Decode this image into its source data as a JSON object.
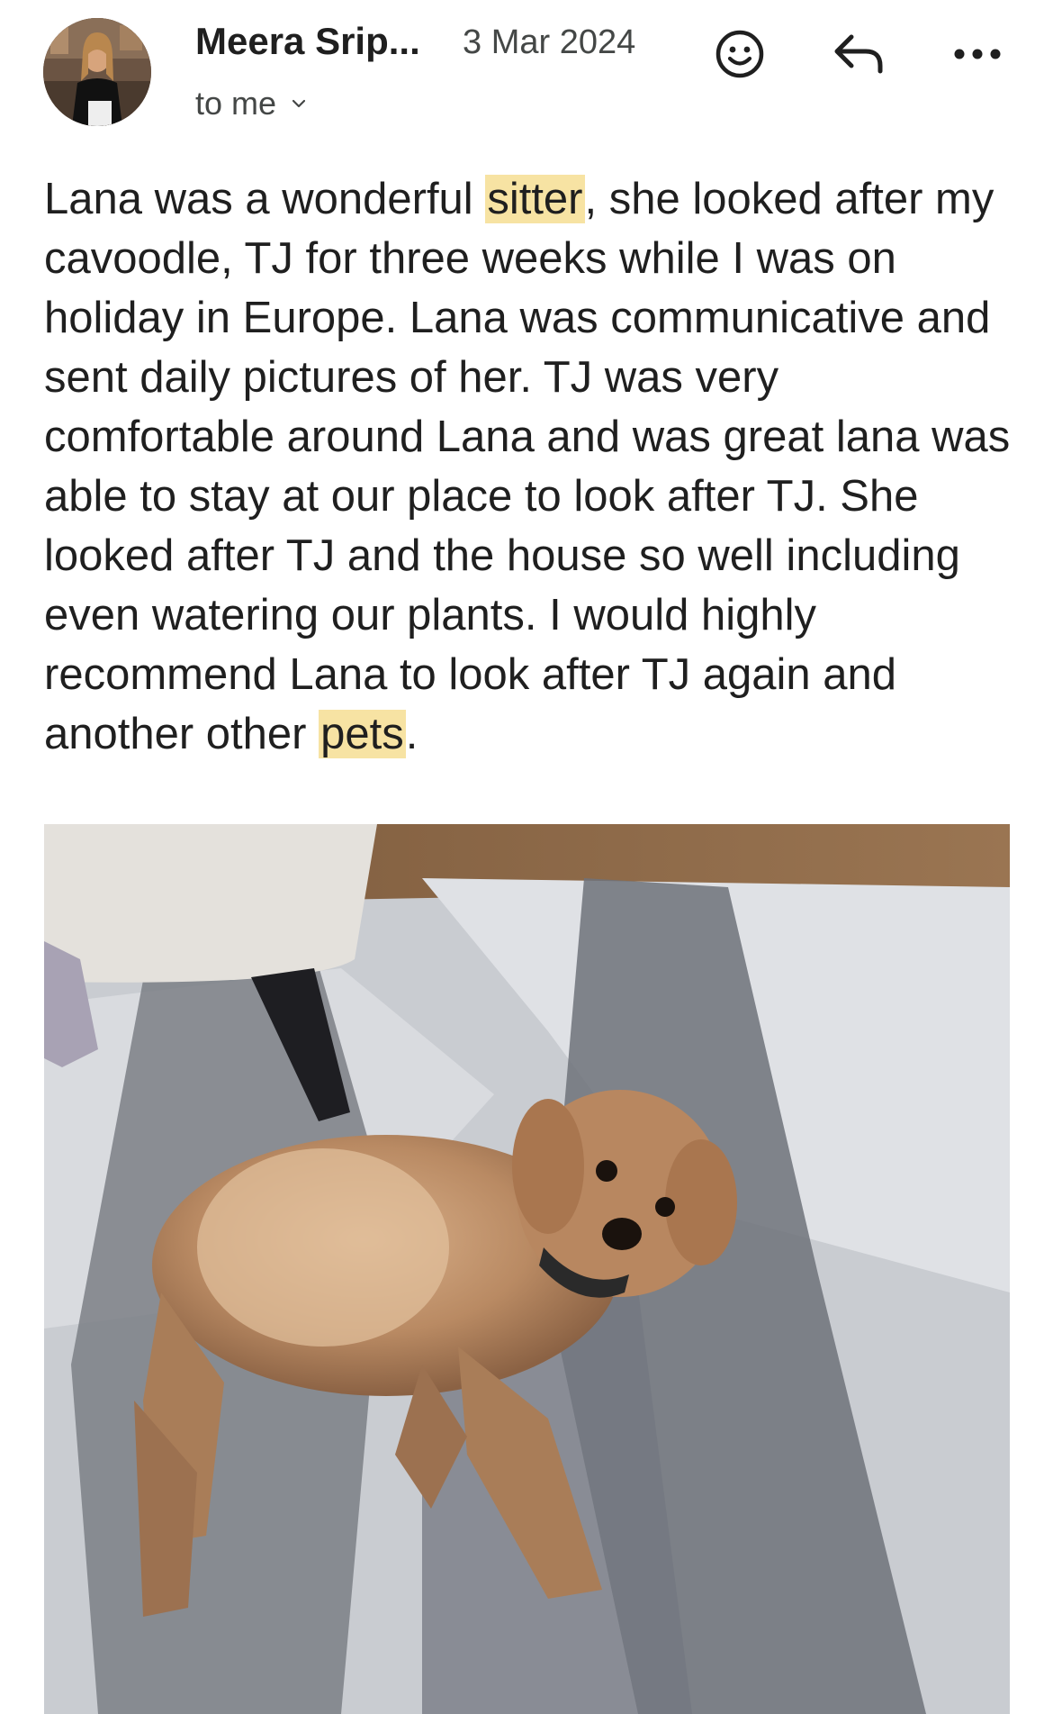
{
  "email": {
    "sender_name": "Meera Srip...",
    "date": "3 Mar 2024",
    "recipient_label": "to me",
    "body_before_hl1": "Lana was a wonderful ",
    "highlight_1": "sitter",
    "body_middle": ", she looked after my cavoodle, TJ for three weeks while I was on holiday in Europe. Lana was communicative and sent daily pictures of her. TJ was very comfortable around Lana and was great lana was able to stay at our place to look after TJ. She looked after TJ and the house so well including even watering our plants. I would highly recommend Lana to look after TJ again and another other ",
    "highlight_2": "pets",
    "body_end": "."
  },
  "icons": {
    "emoji": "smiley-face-icon",
    "reply": "reply-arrow-icon",
    "more": "more-dots-icon",
    "recipient_toggle": "chevron-down-icon"
  },
  "colors": {
    "highlight": "#f7e3a3",
    "text": "#1f1f1f",
    "secondary_text": "#444746"
  }
}
